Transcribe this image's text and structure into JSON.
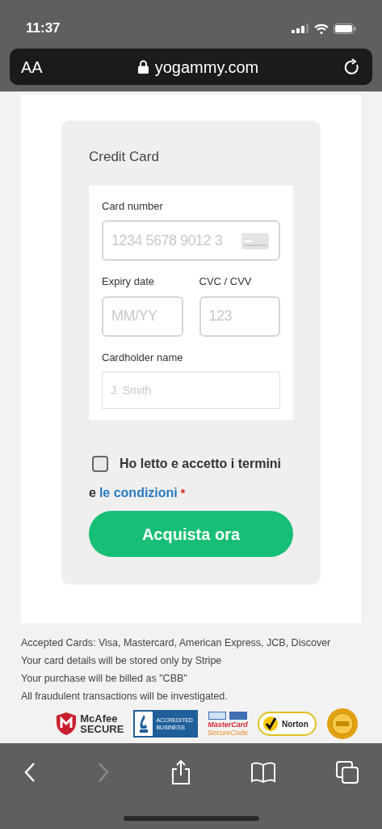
{
  "status_bar": {
    "time": "11:37"
  },
  "address_bar": {
    "text_size_label": "AA",
    "domain": "yogammy.com"
  },
  "payment_form": {
    "title": "Credit Card",
    "fields": [
      {
        "label": "Card number",
        "placeholder": "1234 5678 9012 3",
        "kind": "card"
      },
      {
        "label": "Expiry date",
        "placeholder": "MM/YY",
        "kind": "half"
      },
      {
        "label": "CVC / CVV",
        "placeholder": "123",
        "kind": "half"
      },
      {
        "label": "Cardholder name",
        "placeholder": "J. Smith",
        "kind": "full"
      }
    ],
    "terms": {
      "checked": false,
      "text": "Ho letto e accetto i termini",
      "prefix": "e",
      "link": "le condizioni",
      "required_mark": "*"
    },
    "submit": "Acquista ora"
  },
  "notes": [
    "Accepted Cards: Visa, Mastercard, American Express, JCB, Discover",
    "Your card details will be stored only by Stripe",
    "Your purchase will be billed as \"CBB\"",
    "All fraudulent transactions will be investigated."
  ],
  "badges": [
    {
      "kind": "mcafee",
      "lines": [
        "McAfee",
        "SECURE"
      ]
    },
    {
      "kind": "bbb",
      "lines": [
        "ACCREDITED",
        "BUSINESS"
      ]
    },
    {
      "kind": "mastercard",
      "lines": [
        "MasterCard",
        "SecureCode"
      ]
    },
    {
      "kind": "norton",
      "lines": [
        "Norton"
      ]
    },
    {
      "kind": "seal"
    }
  ],
  "toolbar": {
    "back_disabled": false,
    "forward_disabled": true
  }
}
